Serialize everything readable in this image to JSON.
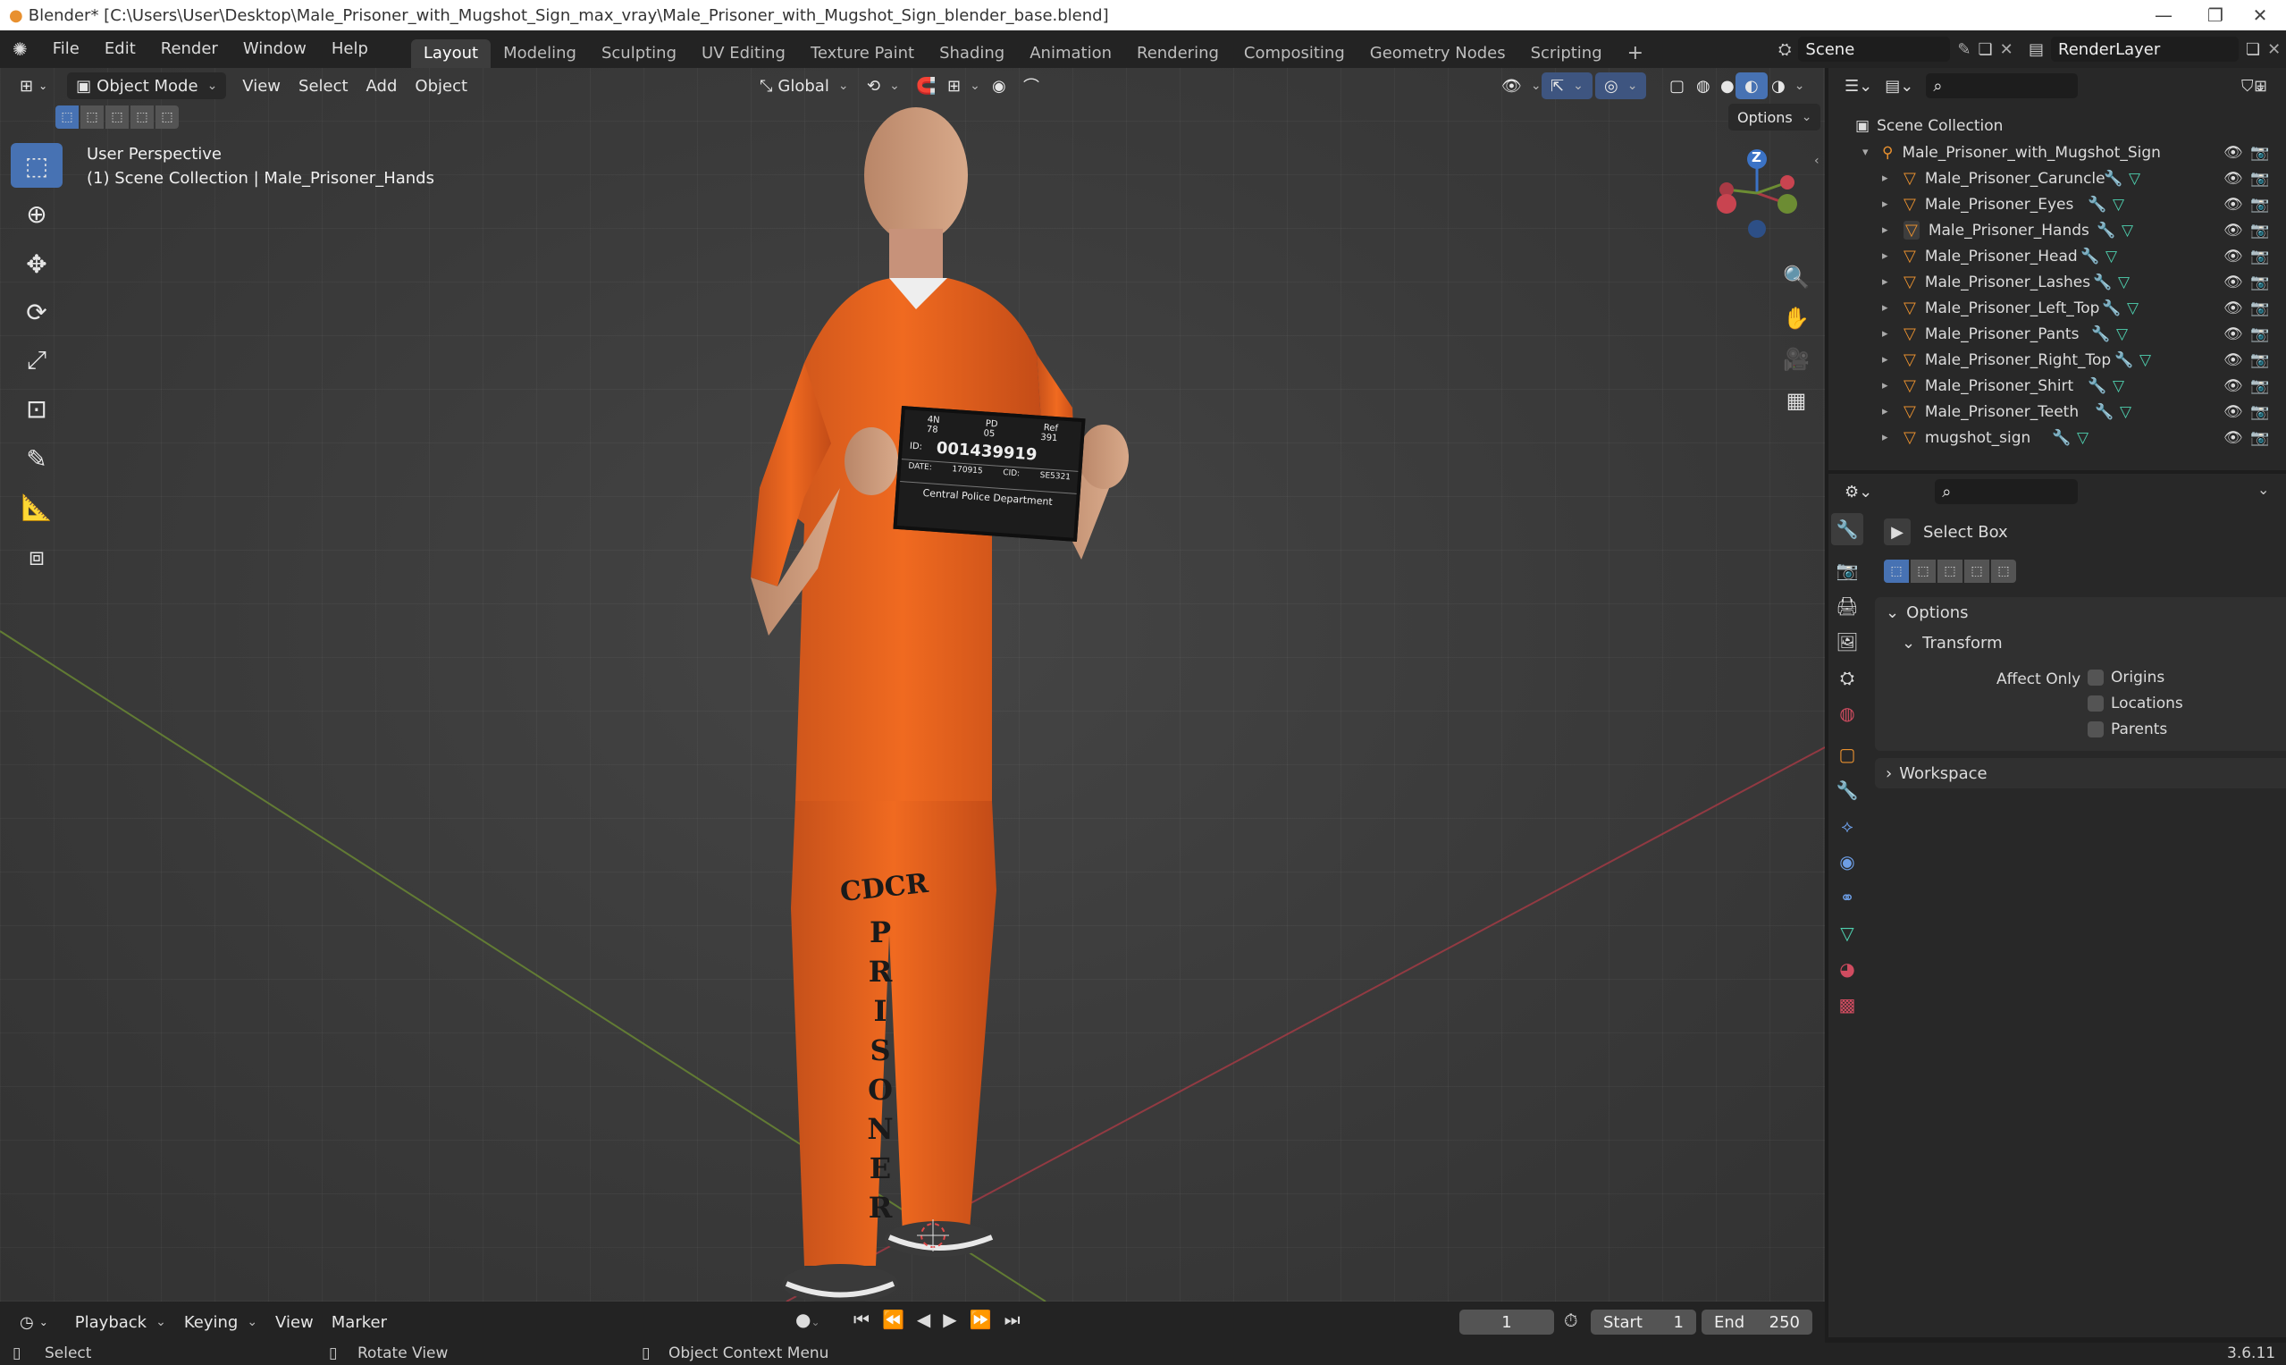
{
  "titlebar": {
    "title": "Blender* [C:\\Users\\User\\Desktop\\Male_Prisoner_with_Mugshot_Sign_max_vray\\Male_Prisoner_with_Mugshot_Sign_blender_base.blend]"
  },
  "menu": {
    "file": "File",
    "edit": "Edit",
    "render": "Render",
    "window": "Window",
    "help": "Help"
  },
  "workspaces": [
    "Layout",
    "Modeling",
    "Sculpting",
    "UV Editing",
    "Texture Paint",
    "Shading",
    "Animation",
    "Rendering",
    "Compositing",
    "Geometry Nodes",
    "Scripting"
  ],
  "scene": {
    "name": "Scene",
    "render_layer": "RenderLayer"
  },
  "viewport": {
    "mode": "Object Mode",
    "view": "View",
    "select": "Select",
    "add": "Add",
    "object": "Object",
    "orientation": "Global",
    "options": "Options",
    "perspective": "User Perspective",
    "collection_info": "(1) Scene Collection | Male_Prisoner_Hands",
    "gizmo_z": "Z"
  },
  "sign": {
    "row1": [
      "4N",
      "PD",
      "Ref"
    ],
    "row2": [
      "78",
      "05",
      "391"
    ],
    "id_label": "ID:",
    "id": "001439919",
    "date_label": "DATE:",
    "date": "170915",
    "cid_label": "CID:",
    "cid": "SE5321",
    "dept": "Central Police Department"
  },
  "pants_text": {
    "cdcr": "CDCR",
    "prisoner": [
      "P",
      "R",
      "I",
      "S",
      "O",
      "N",
      "E",
      "R"
    ]
  },
  "outliner": {
    "scene_collection": "Scene Collection",
    "root": "Male_Prisoner_with_Mugshot_Sign",
    "items": [
      "Male_Prisoner_Caruncle",
      "Male_Prisoner_Eyes",
      "Male_Prisoner_Hands",
      "Male_Prisoner_Head",
      "Male_Prisoner_Lashes",
      "Male_Prisoner_Left_Top",
      "Male_Prisoner_Pants",
      "Male_Prisoner_Right_Top",
      "Male_Prisoner_Shirt",
      "Male_Prisoner_Teeth",
      "mugshot_sign"
    ]
  },
  "properties": {
    "tool_name": "Select Box",
    "options": "Options",
    "transform": "Transform",
    "affect_only": "Affect Only",
    "origins": "Origins",
    "locations": "Locations",
    "parents": "Parents",
    "workspace": "Workspace"
  },
  "timeline": {
    "playback": "Playback",
    "keying": "Keying",
    "view": "View",
    "marker": "Marker",
    "current_frame": "1",
    "start_label": "Start",
    "start": "1",
    "end_label": "End",
    "end": "250"
  },
  "status": {
    "select": "Select",
    "rotate": "Rotate View",
    "context": "Object Context Menu",
    "version": "3.6.11"
  },
  "colors": {
    "accent": "#4772b3",
    "orange": "#e8902f",
    "background": "#1d1d1d"
  }
}
